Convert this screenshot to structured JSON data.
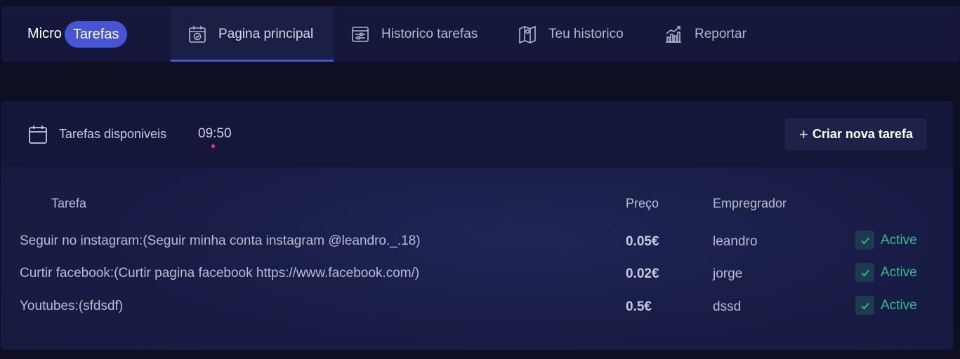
{
  "brand": {
    "left": "Micro",
    "right": "Tarefas"
  },
  "nav": [
    {
      "label": "Pagina principal",
      "icon": "calendar-check-icon",
      "active": true
    },
    {
      "label": "Historico tarefas",
      "icon": "list-settings-icon",
      "active": false
    },
    {
      "label": "Teu historico",
      "icon": "map-icon",
      "active": false
    },
    {
      "label": "Reportar",
      "icon": "bar-chart-growth-icon",
      "active": false
    }
  ],
  "panel": {
    "title": "Tarefas disponiveis",
    "time": "09:50",
    "new_button": "Criar nova tarefa",
    "new_button_icon": "plus-icon"
  },
  "table": {
    "headers": {
      "task": "Tarefa",
      "price": "Preço",
      "employer": "Empregrador"
    },
    "rows": [
      {
        "task": "Seguir no instagram:(Seguir minha conta instagram @leandro._.18)",
        "price": "0.05€",
        "employer": "leandro",
        "status": "Active"
      },
      {
        "task": "Curtir facebook:(Curtir pagina facebook https://www.facebook.com/)",
        "price": "0.02€",
        "employer": "jorge",
        "status": "Active"
      },
      {
        "task": "Youtubes:(sfdsdf)",
        "price": "0.5€",
        "employer": "dssd",
        "status": "Active"
      }
    ]
  },
  "colors": {
    "accent": "#4654d6",
    "active_status": "#2fc089",
    "time_dot": "#ec3d6b",
    "background": "#0e0f22"
  }
}
